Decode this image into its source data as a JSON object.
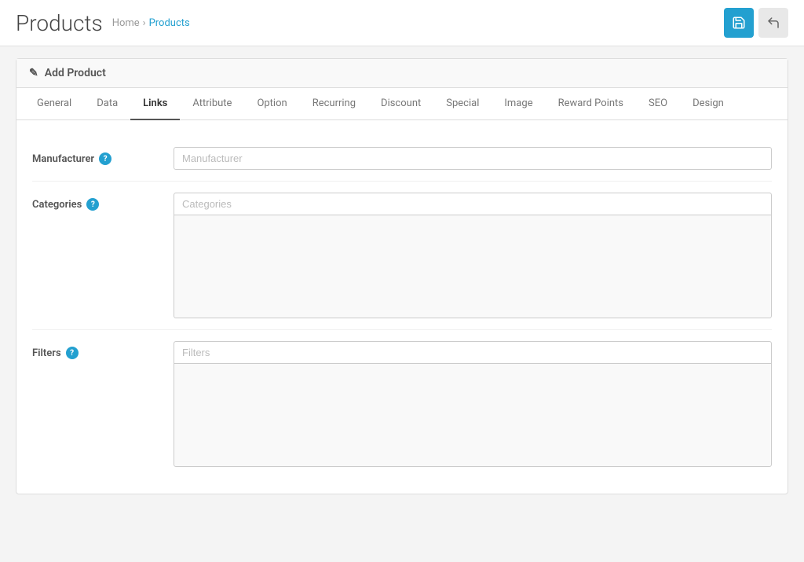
{
  "page": {
    "title": "Products",
    "breadcrumb": {
      "home": "Home",
      "separator": "›",
      "current": "Products"
    }
  },
  "header_buttons": {
    "save_label": "💾",
    "back_label": "↩"
  },
  "card": {
    "header_icon": "✏",
    "header_label": "Add Product"
  },
  "tabs": [
    {
      "id": "general",
      "label": "General",
      "active": false
    },
    {
      "id": "data",
      "label": "Data",
      "active": false
    },
    {
      "id": "links",
      "label": "Links",
      "active": true
    },
    {
      "id": "attribute",
      "label": "Attribute",
      "active": false
    },
    {
      "id": "option",
      "label": "Option",
      "active": false
    },
    {
      "id": "recurring",
      "label": "Recurring",
      "active": false
    },
    {
      "id": "discount",
      "label": "Discount",
      "active": false
    },
    {
      "id": "special",
      "label": "Special",
      "active": false
    },
    {
      "id": "image",
      "label": "Image",
      "active": false
    },
    {
      "id": "reward-points",
      "label": "Reward Points",
      "active": false
    },
    {
      "id": "seo",
      "label": "SEO",
      "active": false
    },
    {
      "id": "design",
      "label": "Design",
      "active": false
    }
  ],
  "form": {
    "manufacturer": {
      "label": "Manufacturer",
      "help": "?",
      "placeholder": "Manufacturer"
    },
    "categories": {
      "label": "Categories",
      "help": "?",
      "placeholder": "Categories"
    },
    "filters": {
      "label": "Filters",
      "help": "?",
      "placeholder": "Filters"
    }
  }
}
